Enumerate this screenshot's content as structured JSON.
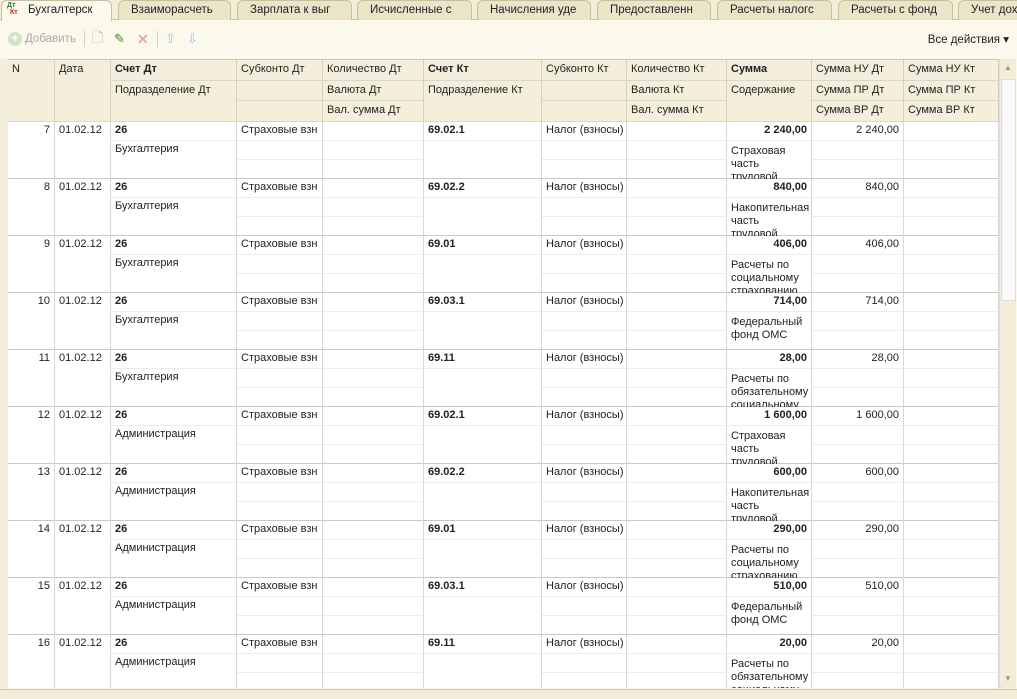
{
  "tabs": [
    "Бухгалтерск",
    "Взаиморасчеть",
    "Зарплата к выг",
    "Исчисленные с",
    "Начисления уде",
    "Предоставленн",
    "Расчеты налогс",
    "Расчеты с фонд",
    "Учет дохо"
  ],
  "toolbar": {
    "add_label": "Добавить",
    "all_actions": "Все действия ▾"
  },
  "headers": {
    "n": "N",
    "date": "Дата",
    "acc_dt": "Счет Дт",
    "dept_dt": "Подразделение Дт",
    "sub_dt": "Субконто Дт",
    "qty_dt": "Количество Дт",
    "cur_dt": "Валюта Дт",
    "cursum_dt": "Вал. сумма Дт",
    "acc_kt": "Счет Кт",
    "dept_kt": "Подразделение Кт",
    "sub_kt": "Субконто Кт",
    "qty_kt": "Количество Кт",
    "cur_kt": "Валюта Кт",
    "cursum_kt": "Вал. сумма Кт",
    "sum": "Сумма",
    "content": "Содержание",
    "nu_dt": "Сумма НУ Дт",
    "pr_dt": "Сумма ПР Дт",
    "vr_dt": "Сумма ВР Дт",
    "nu_kt": "Сумма НУ Кт",
    "pr_kt": "Сумма ПР Кт",
    "vr_kt": "Сумма ВР Кт"
  },
  "rows": [
    {
      "n": "7",
      "date": "01.02.12",
      "acc_dt": "26",
      "dept_dt": "Бухгалтерия",
      "sub_dt": "Страховые взн",
      "acc_kt": "69.02.1",
      "sub_kt": "Налог (взносы)",
      "sum": "2 240,00",
      "content": "Страховая часть трудовой",
      "nu_dt": "2 240,00"
    },
    {
      "n": "8",
      "date": "01.02.12",
      "acc_dt": "26",
      "dept_dt": "Бухгалтерия",
      "sub_dt": "Страховые взн",
      "acc_kt": "69.02.2",
      "sub_kt": "Налог (взносы)",
      "sum": "840,00",
      "content": "Накопительная часть трудовой",
      "nu_dt": "840,00"
    },
    {
      "n": "9",
      "date": "01.02.12",
      "acc_dt": "26",
      "dept_dt": "Бухгалтерия",
      "sub_dt": "Страховые взн",
      "acc_kt": "69.01",
      "sub_kt": "Налог (взносы)",
      "sum": "406,00",
      "content": "Расчеты по социальному страхованию",
      "nu_dt": "406,00"
    },
    {
      "n": "10",
      "date": "01.02.12",
      "acc_dt": "26",
      "dept_dt": "Бухгалтерия",
      "sub_dt": "Страховые взн",
      "acc_kt": "69.03.1",
      "sub_kt": "Налог (взносы)",
      "sum": "714,00",
      "content": "Федеральный фонд ОМС",
      "nu_dt": "714,00"
    },
    {
      "n": "11",
      "date": "01.02.12",
      "acc_dt": "26",
      "dept_dt": "Бухгалтерия",
      "sub_dt": "Страховые взн",
      "acc_kt": "69.11",
      "sub_kt": "Налог (взносы)",
      "sum": "28,00",
      "content": "Расчеты по обязательному социальному",
      "nu_dt": "28,00"
    },
    {
      "n": "12",
      "date": "01.02.12",
      "acc_dt": "26",
      "dept_dt": "Администрация",
      "sub_dt": "Страховые взн",
      "acc_kt": "69.02.1",
      "sub_kt": "Налог (взносы)",
      "sum": "1 600,00",
      "content": "Страховая часть трудовой",
      "nu_dt": "1 600,00"
    },
    {
      "n": "13",
      "date": "01.02.12",
      "acc_dt": "26",
      "dept_dt": "Администрация",
      "sub_dt": "Страховые взн",
      "acc_kt": "69.02.2",
      "sub_kt": "Налог (взносы)",
      "sum": "600,00",
      "content": "Накопительная часть трудовой",
      "nu_dt": "600,00"
    },
    {
      "n": "14",
      "date": "01.02.12",
      "acc_dt": "26",
      "dept_dt": "Администрация",
      "sub_dt": "Страховые взн",
      "acc_kt": "69.01",
      "sub_kt": "Налог (взносы)",
      "sum": "290,00",
      "content": "Расчеты по социальному страхованию",
      "nu_dt": "290,00"
    },
    {
      "n": "15",
      "date": "01.02.12",
      "acc_dt": "26",
      "dept_dt": "Администрация",
      "sub_dt": "Страховые взн",
      "acc_kt": "69.03.1",
      "sub_kt": "Налог (взносы)",
      "sum": "510,00",
      "content": "Федеральный фонд ОМС",
      "nu_dt": "510,00"
    },
    {
      "n": "16",
      "date": "01.02.12",
      "acc_dt": "26",
      "dept_dt": "Администрация",
      "sub_dt": "Страховые взн",
      "acc_kt": "69.11",
      "sub_kt": "Налог (взносы)",
      "sum": "20,00",
      "content": "Расчеты по обязательному социальному",
      "nu_dt": "20,00"
    }
  ]
}
